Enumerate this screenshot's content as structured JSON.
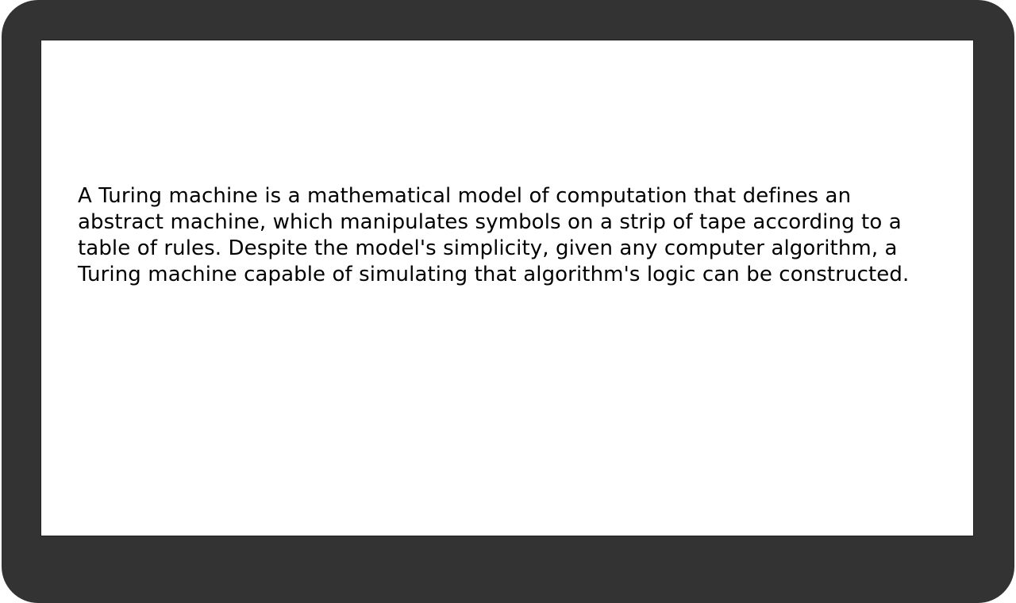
{
  "screen": {
    "paragraph": "A Turing machine is a mathematical model of computation that defines an abstract machine, which manipulates symbols on a strip of tape according to a table of rules. Despite the model's simplicity, given any computer algorithm, a Turing machine capable of simulating that algorithm's logic can be constructed."
  },
  "colors": {
    "frame": "#333333",
    "screen_background": "#ffffff",
    "text": "#000000"
  }
}
